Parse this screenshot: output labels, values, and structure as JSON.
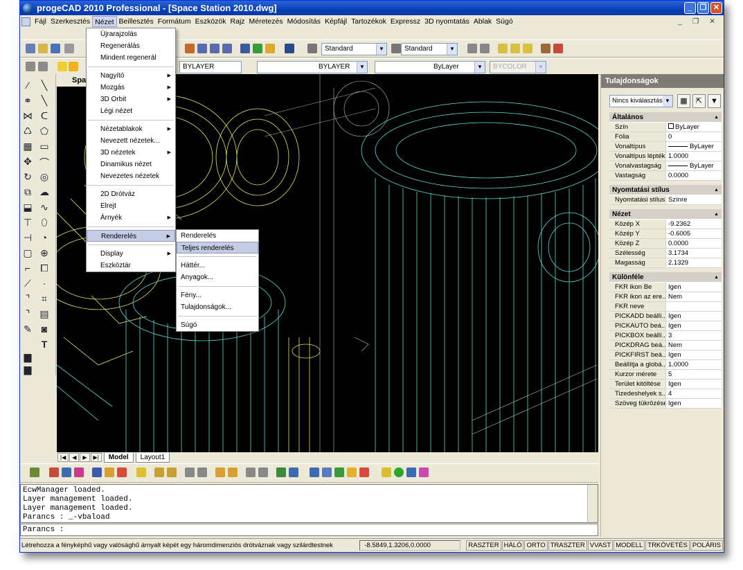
{
  "window": {
    "title": "progeCAD 2010 Professional - [Space Station 2010.dwg]"
  },
  "menubar": [
    "Fájl",
    "Szerkesztés",
    "Nézet",
    "Beillesztés",
    "Formátum",
    "Eszközök",
    "Rajz",
    "Méretezés",
    "Módosítás",
    "Képfájl",
    "Tartozékok",
    "Expressz",
    "3D nyomtatás",
    "Ablak",
    "Súgó"
  ],
  "toolbar": {
    "text_style": "Standard",
    "dim_style": "Standard",
    "layer_color": "BYLAYER",
    "linetype": "BYLAYER",
    "lineweight": "ByLayer",
    "plotstyle": "BYCOLOR"
  },
  "drawing": {
    "tab_label": "Spac"
  },
  "nezet_menu": {
    "group1": [
      "Újrarajzolás",
      "Regenerálás",
      "Mindent regenerál"
    ],
    "group2": [
      "Nagyító",
      "Mozgás",
      "3D Orbit",
      "Légi nézet"
    ],
    "group3": [
      "Nézetablakok",
      "Nevezett nézetek...",
      "3D nézetek",
      "Dinamikus nézet",
      "Nevezetes nézetek"
    ],
    "group4": [
      "2D Drótváz",
      "Elrejt",
      "Árnyék"
    ],
    "group5": [
      "Renderelés"
    ],
    "group6": [
      "Display",
      "Eszköztár"
    ]
  },
  "render_menu": {
    "items1": [
      "Renderelés",
      "Teljes renderelés"
    ],
    "items2": [
      "Háttér...",
      "Anyagok..."
    ],
    "items3": [
      "Fény...",
      "Tulajdonságok..."
    ],
    "items4": [
      "Súgó"
    ]
  },
  "tabs": {
    "model": "Model",
    "layout": "Layout1"
  },
  "command": {
    "history": [
      "EcwManager loaded.",
      "Layer management loaded.",
      "Layer management loaded.",
      "Parancs : _-vbaload"
    ],
    "prompt": "Parancs :"
  },
  "statusbar": {
    "message": "Létrehozza a fényképhű vagy valósághű árnyalt képét egy háromdimenziós drótváznak vagy szilárdtestnek",
    "coords": "-8.5849,1.3206,0.0000",
    "toggles": [
      "RASZTER",
      "HÁLÓ",
      "ORTO",
      "TRASZTER",
      "VVAST",
      "MODELL",
      "TRKÖVETÉS",
      "POLÁRIS"
    ]
  },
  "properties": {
    "title": "Tulajdonságok",
    "selection": "Nincs kiválasztás",
    "cat_general": "Általános",
    "general": [
      [
        "Szín",
        "ByLayer"
      ],
      [
        "Fólia",
        "0"
      ],
      [
        "Vonaltípus",
        "ByLayer"
      ],
      [
        "Vonaltípus lépték",
        "1.0000"
      ],
      [
        "Vonalvastagság",
        "ByLayer"
      ],
      [
        "Vastagság",
        "0.0000"
      ]
    ],
    "cat_plot": "Nyomtatási stílus",
    "plot": [
      [
        "Nyomtatási stílus",
        "Színre"
      ]
    ],
    "cat_view": "Nézet",
    "view": [
      [
        "Közép X",
        "-9.2362"
      ],
      [
        "Közép Y",
        "-0.6005"
      ],
      [
        "Közép Z",
        "0.0000"
      ],
      [
        "Szélesség",
        "3.1734"
      ],
      [
        "Magasság",
        "2.1329"
      ]
    ],
    "cat_misc": "Különféle",
    "misc": [
      [
        "FKR ikon Be",
        "Igen"
      ],
      [
        "FKR ikon az ere...",
        "Nem"
      ],
      [
        "FKR neve",
        ""
      ],
      [
        "PICKADD beállí...",
        "Igen"
      ],
      [
        "PICKAUTO beá...",
        "Igen"
      ],
      [
        "PICKBOX beállí...",
        "3"
      ],
      [
        "PICKDRAG beá...",
        "Nem"
      ],
      [
        "PICKFIRST beá...",
        "Igen"
      ],
      [
        "Beállítja a globá...",
        "1.0000"
      ],
      [
        "Kurzor mérete",
        "5"
      ],
      [
        "Terület kitöltése",
        "Igen"
      ],
      [
        "Tizedeshelyek s...",
        "4"
      ],
      [
        "Szöveg tükrözése",
        "Igen"
      ]
    ]
  }
}
